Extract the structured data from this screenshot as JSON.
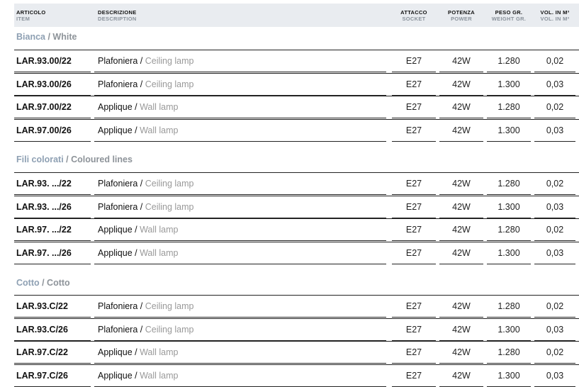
{
  "header": {
    "item_it": "ARTICOLO",
    "item_en": "ITEM",
    "desc_it": "DESCRIZIONE",
    "desc_en": "DESCRIPTION",
    "socket_it": "ATTACCO",
    "socket_en": "SOCKET",
    "power_it": "POTENZA",
    "power_en": "POWER",
    "weight_it": "PESO GR.",
    "weight_en": "WEIGHT GR.",
    "vol_it": "VOL. IN M³",
    "vol_en": "VOL. IN M³"
  },
  "sections": [
    {
      "title_it": "Bianca",
      "sep": " / ",
      "title_en": "White",
      "rows": [
        {
          "code": "LAR.93.00/22",
          "desc_it": "Plafoniera",
          "sep": " / ",
          "desc_en": "Ceiling lamp",
          "socket": "E27",
          "power": "42W",
          "weight": "1.280",
          "vol": "0,02"
        },
        {
          "code": "LAR.93.00/26",
          "desc_it": "Plafoniera",
          "sep": " / ",
          "desc_en": "Ceiling lamp",
          "socket": "E27",
          "power": "42W",
          "weight": "1.300",
          "vol": "0,03"
        },
        {
          "code": "LAR.97.00/22",
          "desc_it": "Applique",
          "sep": " / ",
          "desc_en": "Wall lamp",
          "socket": "E27",
          "power": "42W",
          "weight": "1.280",
          "vol": "0,02"
        },
        {
          "code": "LAR.97.00/26",
          "desc_it": "Applique",
          "sep": " / ",
          "desc_en": "Wall lamp",
          "socket": "E27",
          "power": "42W",
          "weight": "1.300",
          "vol": "0,03"
        }
      ]
    },
    {
      "title_it": "Fili colorati",
      "sep": " / ",
      "title_en": "Coloured lines",
      "rows": [
        {
          "code": "LAR.93. .../22",
          "desc_it": "Plafoniera",
          "sep": " / ",
          "desc_en": "Ceiling lamp",
          "socket": "E27",
          "power": "42W",
          "weight": "1.280",
          "vol": "0,02"
        },
        {
          "code": "LAR.93. .../26",
          "desc_it": "Plafoniera",
          "sep": " / ",
          "desc_en": "Ceiling lamp",
          "socket": "E27",
          "power": "42W",
          "weight": "1.300",
          "vol": "0,03"
        },
        {
          "code": "LAR.97. .../22",
          "desc_it": "Applique",
          "sep": " / ",
          "desc_en": "Wall lamp",
          "socket": "E27",
          "power": "42W",
          "weight": "1.280",
          "vol": "0,02"
        },
        {
          "code": "LAR.97. .../26",
          "desc_it": "Applique",
          "sep": " / ",
          "desc_en": "Wall lamp",
          "socket": "E27",
          "power": "42W",
          "weight": "1.300",
          "vol": "0,03"
        }
      ]
    },
    {
      "title_it": "Cotto",
      "sep": " / ",
      "title_en": "Cotto",
      "rows": [
        {
          "code": "LAR.93.C/22",
          "desc_it": "Plafoniera",
          "sep": " / ",
          "desc_en": "Ceiling lamp",
          "socket": "E27",
          "power": "42W",
          "weight": "1.280",
          "vol": "0,02"
        },
        {
          "code": "LAR.93.C/26",
          "desc_it": "Plafoniera",
          "sep": " / ",
          "desc_en": "Ceiling lamp",
          "socket": "E27",
          "power": "42W",
          "weight": "1.300",
          "vol": "0,03"
        },
        {
          "code": "LAR.97.C/22",
          "desc_it": "Applique",
          "sep": " / ",
          "desc_en": "Wall lamp",
          "socket": "E27",
          "power": "42W",
          "weight": "1.280",
          "vol": "0,02"
        },
        {
          "code": "LAR.97.C/26",
          "desc_it": "Applique",
          "sep": " / ",
          "desc_en": "Wall lamp",
          "socket": "E27",
          "power": "42W",
          "weight": "1.300",
          "vol": "0,03"
        }
      ]
    }
  ]
}
